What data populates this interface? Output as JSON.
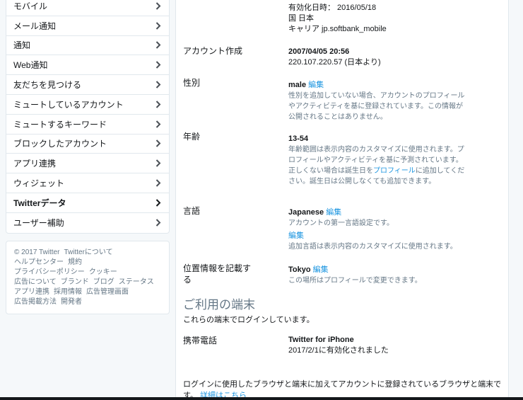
{
  "sidebar": {
    "items": [
      {
        "label": "モバイル"
      },
      {
        "label": "メール通知"
      },
      {
        "label": "通知"
      },
      {
        "label": "Web通知"
      },
      {
        "label": "友だちを見つける"
      },
      {
        "label": "ミュートしているアカウント"
      },
      {
        "label": "ミュートするキーワード"
      },
      {
        "label": "ブロックしたアカウント"
      },
      {
        "label": "アプリ連携"
      },
      {
        "label": "ウィジェット"
      },
      {
        "label": "Twitterデータ"
      },
      {
        "label": "ユーザー補助"
      }
    ],
    "footer": {
      "copyright": "© 2017 Twitter",
      "about": "Twitterについて",
      "help": "ヘルプセンター",
      "terms": "規約",
      "privacy": "プライバシーポリシー",
      "cookies": "クッキー",
      "ads_info": "広告について",
      "brand": "ブランド",
      "blog": "ブログ",
      "status": "ステータス",
      "apps": "アプリ連携",
      "jobs": "採用情報",
      "ads_manager": "広告管理画面",
      "advertise": "広告掲載方法",
      "developers": "開発者"
    }
  },
  "main": {
    "phone": {
      "activated": "有効化日時： 2016/05/18",
      "country": "国 日本",
      "carrier": "キャリア jp.softbank_mobile"
    },
    "account_creation": {
      "label": "アカウント作成",
      "datetime": "2007/04/05 20:56",
      "ip": "220.107.220.57 (日本より)"
    },
    "gender": {
      "label": "性別",
      "value": "male",
      "edit": "編集",
      "desc": "性別を追加していない場合、アカウントのプロフィールやアクティビティを基に登録されています。この情報が公開されることはありません。"
    },
    "age": {
      "label": "年齢",
      "value": "13-54",
      "desc_1": "年齢範囲は表示内容のカスタマイズに使用されます。プロフィールやアクティビティを基に予測されています。 正しくない場合は誕生日を",
      "profile_link": "プロフィール",
      "desc_2": "に追加してください。誕生日は公開しなくても追加できます。"
    },
    "language": {
      "label": "言語",
      "value": "Japanese",
      "edit": "編集",
      "desc": "アカウントの第一言語設定です。",
      "edit2": "編集",
      "desc2": "追加言語は表示内容のカスタマイズに使用されます。"
    },
    "location": {
      "label": "位置情報を記載する",
      "value": "Tokyo",
      "edit": "編集",
      "desc": "この場所はプロフィールで変更できます。"
    },
    "devices": {
      "title": "ご利用の端末",
      "intro": "これらの端末でログインしています。",
      "label": "携帯電話",
      "device_name": "Twitter for iPhone",
      "device_activated": "2017/2/1に有効化されました",
      "bottom_text": "ログインに使用したブラウザと端末に加えてアカウントに登録されているブラウザと端末です。",
      "details_link": "詳細はこちら"
    }
  }
}
